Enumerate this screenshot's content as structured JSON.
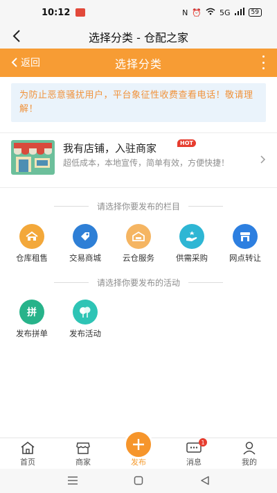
{
  "status_bar": {
    "time": "10:12",
    "battery": "59",
    "network": "5G"
  },
  "titlebar": {
    "title": "选择分类 - 仓配之家"
  },
  "navbar": {
    "back_label": "返回",
    "title": "选择分类"
  },
  "notice": {
    "text": "为防止恶意骚扰用户，平台象征性收费查看电话！敬请理解！"
  },
  "merchant": {
    "title": "我有店铺，入驻商家",
    "badge": "HOT",
    "description": "超低成本，本地宣传，简单有效，方便快捷！"
  },
  "columns_section": {
    "heading": "请选择你要发布的栏目",
    "items": [
      {
        "label": "仓库租售",
        "icon": "warehouse-icon",
        "color": "#f3a83a"
      },
      {
        "label": "交易商城",
        "icon": "tag-icon",
        "color": "#2e7fd6"
      },
      {
        "label": "云仓服务",
        "icon": "cloud-warehouse-icon",
        "color": "#f5b562"
      },
      {
        "label": "供需采购",
        "icon": "hand-icon",
        "color": "#2eb6d4"
      },
      {
        "label": "网点转让",
        "icon": "store-icon",
        "color": "#2d7fe0"
      }
    ]
  },
  "activities_section": {
    "heading": "请选择你要发布的活动",
    "items": [
      {
        "label": "发布拼单",
        "icon": "pin-icon",
        "glyph": "拼",
        "color": "#27b38a"
      },
      {
        "label": "发布活动",
        "icon": "activity-icon",
        "color": "#2ec4b5"
      }
    ]
  },
  "tabbar": {
    "tabs": [
      {
        "label": "首页",
        "icon": "home-icon"
      },
      {
        "label": "商家",
        "icon": "merchant-icon"
      },
      {
        "label": "发布",
        "icon": "plus-icon",
        "active": true
      },
      {
        "label": "消息",
        "icon": "message-icon",
        "badge": "1"
      },
      {
        "label": "我的",
        "icon": "user-icon"
      }
    ]
  },
  "colors": {
    "accent": "#f79c34",
    "notice_bg": "#eaf3fb",
    "notice_text": "#f0923a"
  }
}
